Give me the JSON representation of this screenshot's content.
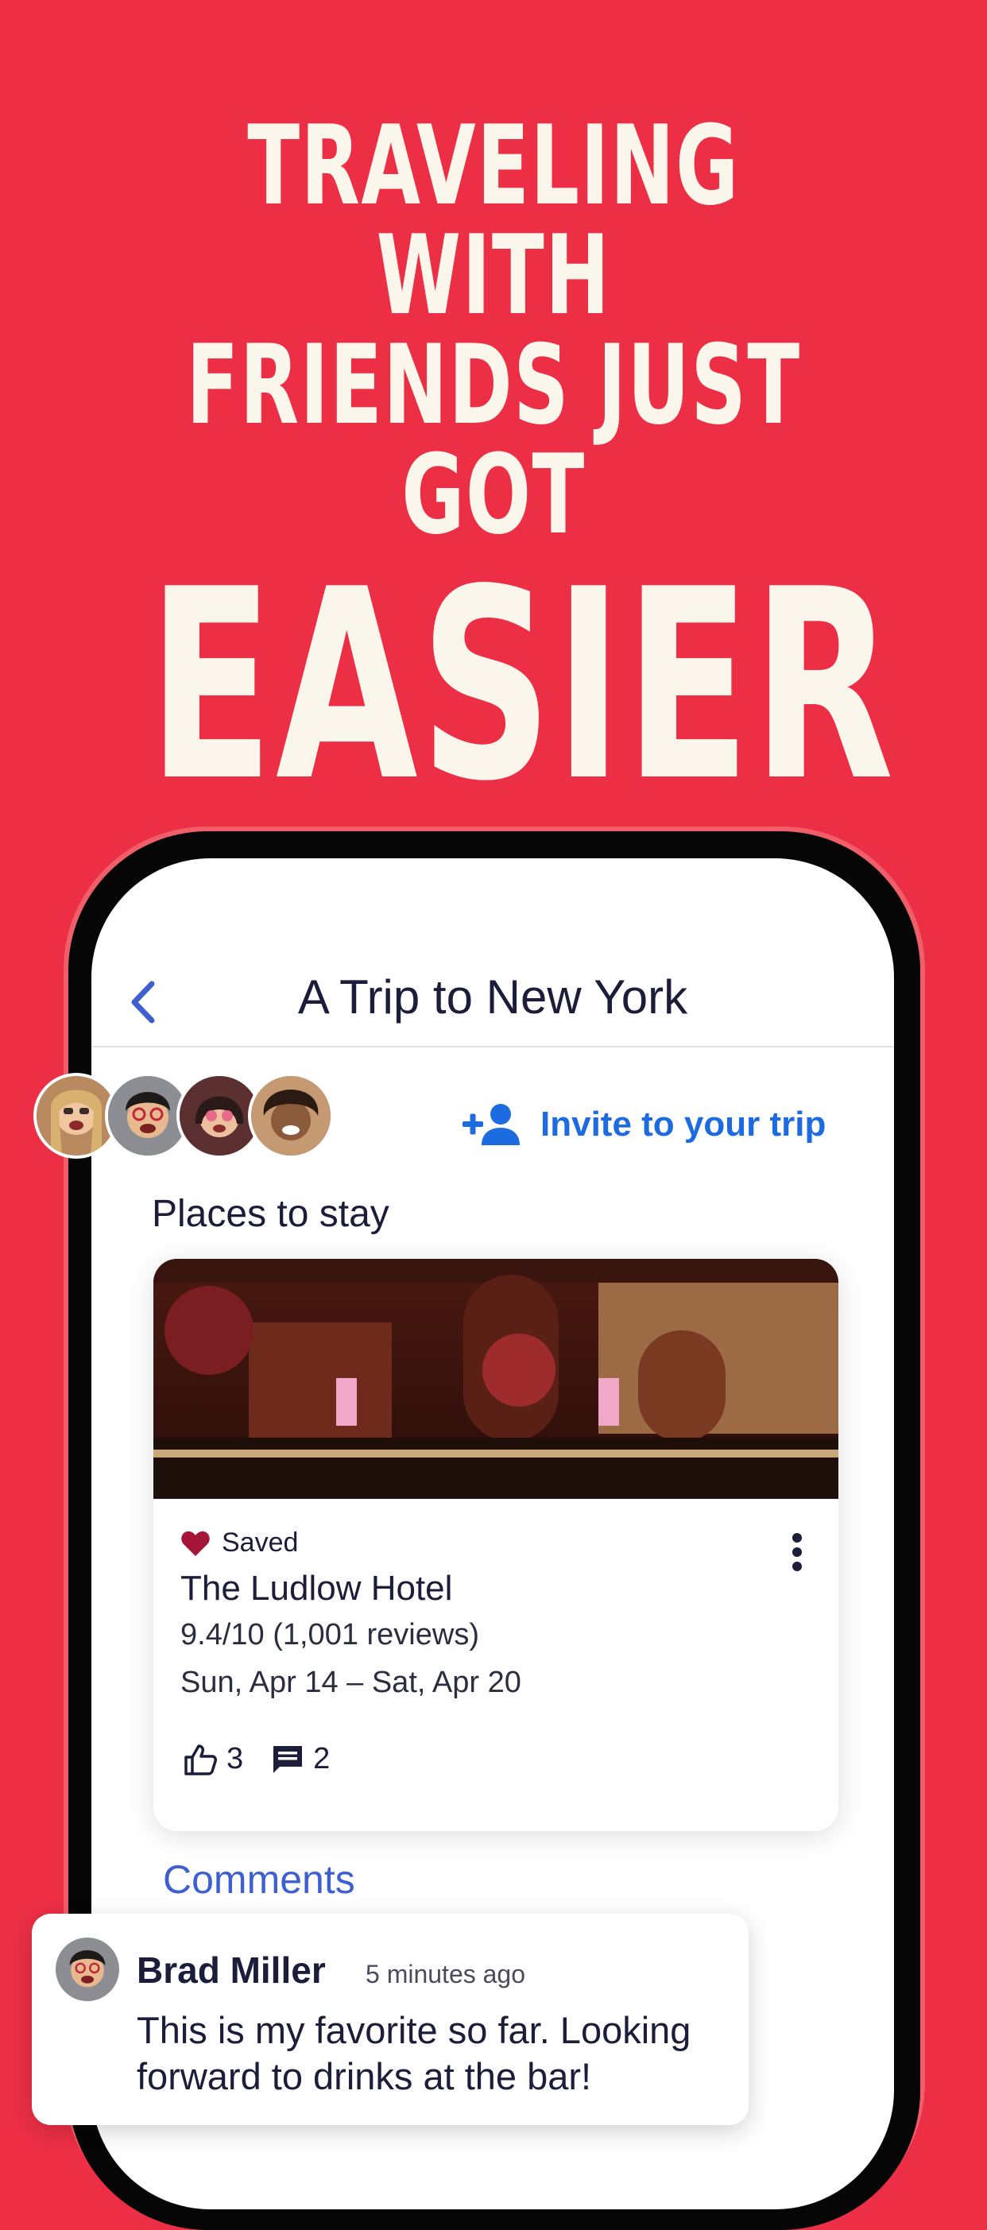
{
  "headline": {
    "line1": "TRAVELING WITH",
    "line2": "FRIENDS JUST GOT",
    "line3": "EASIER"
  },
  "screen": {
    "title": "A Trip to New York",
    "invite_label": "Invite to your trip",
    "section_title": "Places to stay",
    "card": {
      "saved_label": "Saved",
      "hotel_name": "The Ludlow Hotel",
      "rating": "9.4/10 (1,001 reviews)",
      "dates": "Sun, Apr 14 – Sat, Apr 20",
      "likes": "3",
      "comments": "2"
    },
    "comments_title": "Comments"
  },
  "comment": {
    "author": "Brad Miller",
    "time": "5 minutes ago",
    "text": "This is my favorite so far. Looking forward to drinks at the bar!"
  },
  "colors": {
    "background": "#ED2F46",
    "headline": "#FBF6EC",
    "accent_blue": "#1C6BE0",
    "comments_blue": "#3D5FD0",
    "heart": "#A5153A"
  },
  "icons": [
    "back-chevron-icon",
    "add-person-icon",
    "heart-icon",
    "more-vertical-icon",
    "thumbs-up-icon",
    "comment-icon"
  ]
}
